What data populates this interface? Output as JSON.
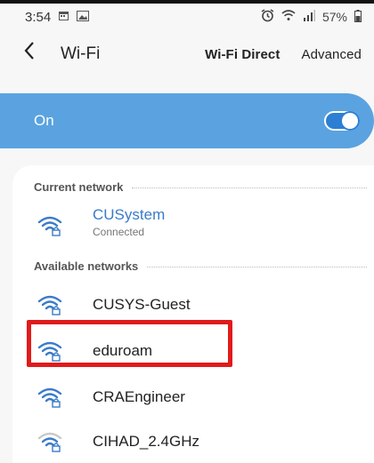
{
  "status_bar": {
    "time": "3:54",
    "battery": "57%",
    "left_icons": [
      "calendar-icon",
      "image-icon"
    ],
    "right_icons": [
      "alarm-icon",
      "wifi-status-icon",
      "signal-icon",
      "battery-icon"
    ]
  },
  "header": {
    "title": "Wi-Fi",
    "actions": {
      "wifi_direct": "Wi-Fi Direct",
      "advanced": "Advanced"
    }
  },
  "toggle": {
    "label": "On",
    "state": true
  },
  "current_network": {
    "header": "Current network",
    "name": "CUSystem",
    "status": "Connected"
  },
  "available_networks": {
    "header": "Available networks",
    "items": [
      {
        "name": "CUSYS-Guest",
        "signal": "full",
        "color": "#3a7bc8"
      },
      {
        "name": "eduroam",
        "signal": "full",
        "color": "#3a7bc8"
      },
      {
        "name": "CRAEngineer",
        "signal": "full",
        "color": "#3a7bc8"
      },
      {
        "name": "CIHAD_2.4GHz",
        "signal": "weak",
        "color": "#3a7bc8"
      }
    ]
  },
  "colors": {
    "accent": "#5aa3e0",
    "highlight": "#e01b1b"
  }
}
